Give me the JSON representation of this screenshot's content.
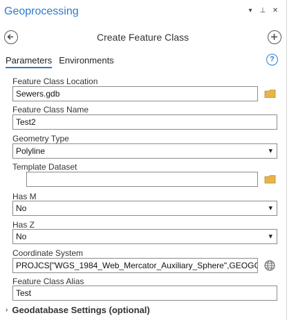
{
  "pane": {
    "title": "Geoprocessing"
  },
  "titlebar_icons": [
    "▾",
    "⊥",
    "✕"
  ],
  "tool": {
    "title": "Create Feature Class",
    "back_icon": "back-arrow-icon",
    "add_icon": "add-icon"
  },
  "tabs": [
    {
      "label": "Parameters",
      "active": true
    },
    {
      "label": "Environments",
      "active": false
    }
  ],
  "help_label": "?",
  "params": {
    "location": {
      "label": "Feature Class Location",
      "value": "Sewers.gdb"
    },
    "name": {
      "label": "Feature Class Name",
      "value": "Test2"
    },
    "geometry": {
      "label": "Geometry Type",
      "value": "Polyline"
    },
    "template": {
      "label": "Template Dataset",
      "value": ""
    },
    "has_m": {
      "label": "Has M",
      "value": "No"
    },
    "has_z": {
      "label": "Has Z",
      "value": "No"
    },
    "coord": {
      "label": "Coordinate System",
      "value": "PROJCS[\"WGS_1984_Web_Mercator_Auxiliary_Sphere\",GEOGCS[\"G"
    },
    "alias": {
      "label": "Feature Class Alias",
      "value": "Test"
    }
  },
  "section": {
    "label": "Geodatabase Settings (optional)",
    "chevron": "›"
  },
  "colors": {
    "accent": "#2b7bd0",
    "folder": "#e8b44a"
  }
}
